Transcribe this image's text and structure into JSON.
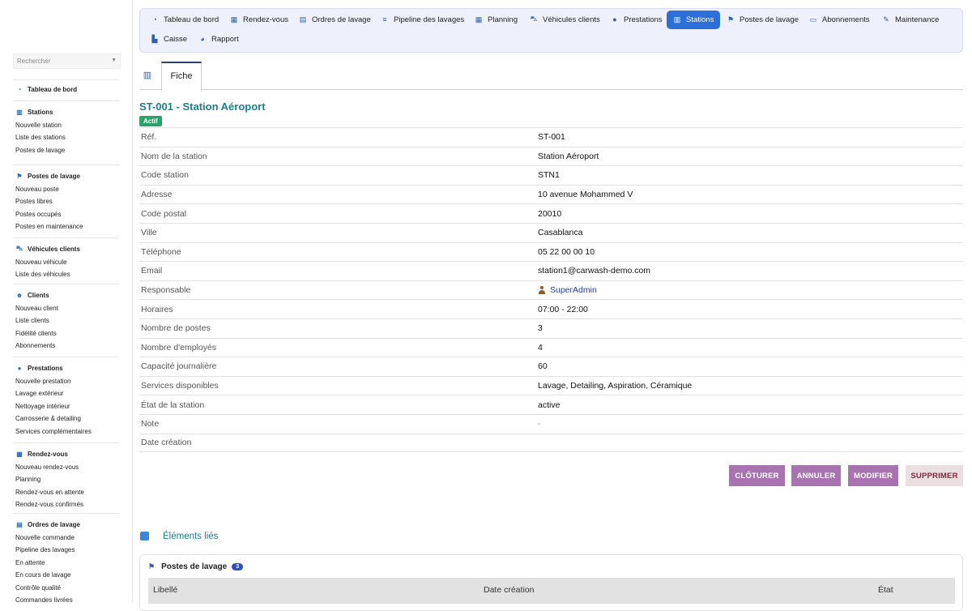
{
  "search": {
    "placeholder": "Rechercher"
  },
  "sidebar": {
    "dashboard": "Tableau de bord",
    "sections": [
      {
        "title": "Stations",
        "items": [
          "Nouvelle station",
          "Liste des stations",
          "Postes de lavage"
        ]
      },
      {
        "title": "Postes de lavage",
        "items": [
          "Nouveau poste",
          "Postes libres",
          "Postes occupés",
          "Postes en maintenance"
        ]
      },
      {
        "title": "Véhicules clients",
        "items": [
          "Nouveau véhicule",
          "Liste des véhicules"
        ]
      },
      {
        "title": "Clients",
        "items": [
          "Nouveau client",
          "Liste clients",
          "Fidélité clients",
          "Abonnements"
        ]
      },
      {
        "title": "Prestations",
        "items": [
          "Nouvelle prestation",
          "Lavage extérieur",
          "Nettoyage intérieur",
          "Carrosserie & detailing",
          "Services complémentaires"
        ]
      },
      {
        "title": "Rendez-vous",
        "items": [
          "Nouveau rendez-vous",
          "Planning",
          "Rendez-vous en attente",
          "Rendez-vous confirmés"
        ]
      },
      {
        "title": "Ordres de lavage",
        "items": [
          "Nouvelle commande",
          "Pipeline des lavages",
          "En attente",
          "En cours de lavage",
          "Contrôle qualité",
          "Commandes livrées"
        ]
      }
    ]
  },
  "topnav": {
    "items": [
      "Tableau de bord",
      "Rendez-vous",
      "Ordres de lavage",
      "Pipeline des lavages",
      "Planning",
      "Véhicules clients",
      "Prestations",
      "Stations",
      "Postes de lavage",
      "Abonnements",
      "Maintenance",
      "Caisse",
      "Rapport"
    ],
    "active": "Stations"
  },
  "tabs": {
    "fiche": "Fiche"
  },
  "record": {
    "title": "ST-001 - Station Aéroport",
    "status": "Actif",
    "fields": [
      {
        "label": "Réf.",
        "value": "ST-001"
      },
      {
        "label": "Nom de la station",
        "value": "Station Aéroport"
      },
      {
        "label": "Code station",
        "value": "STN1"
      },
      {
        "label": "Adresse",
        "value": "10 avenue Mohammed V"
      },
      {
        "label": "Code postal",
        "value": "20010"
      },
      {
        "label": "Ville",
        "value": "Casablanca"
      },
      {
        "label": "Téléphone",
        "value": "05 22 00 00 10"
      },
      {
        "label": "Email",
        "value": "station1@carwash-demo.com"
      },
      {
        "label": "Responsable",
        "value": "SuperAdmin"
      },
      {
        "label": "Horaires",
        "value": "07:00 - 22:00"
      },
      {
        "label": "Nombre de postes",
        "value": "3"
      },
      {
        "label": "Nombre d'employés",
        "value": "4"
      },
      {
        "label": "Capacité journalière",
        "value": "60"
      },
      {
        "label": "Services disponibles",
        "value": "Lavage, Detailing, Aspiration, Céramique"
      },
      {
        "label": "État de la station",
        "value": "active"
      },
      {
        "label": "Note",
        "value": "-"
      },
      {
        "label": "Date création",
        "value": ""
      }
    ]
  },
  "actions": {
    "close": "CLÔTURER",
    "cancel": "ANNULER",
    "edit": "MODIFIER",
    "delete": "SUPPRIMER"
  },
  "related": {
    "title": "Éléments liés",
    "block_title": "Postes de lavage",
    "count": "3",
    "columns": [
      "Libellé",
      "Date création",
      "État"
    ]
  },
  "colors": {
    "accent": "#2c6fd8",
    "title": "#1a7f8f",
    "badge": "#2aa36b",
    "button": "#a774b0"
  }
}
